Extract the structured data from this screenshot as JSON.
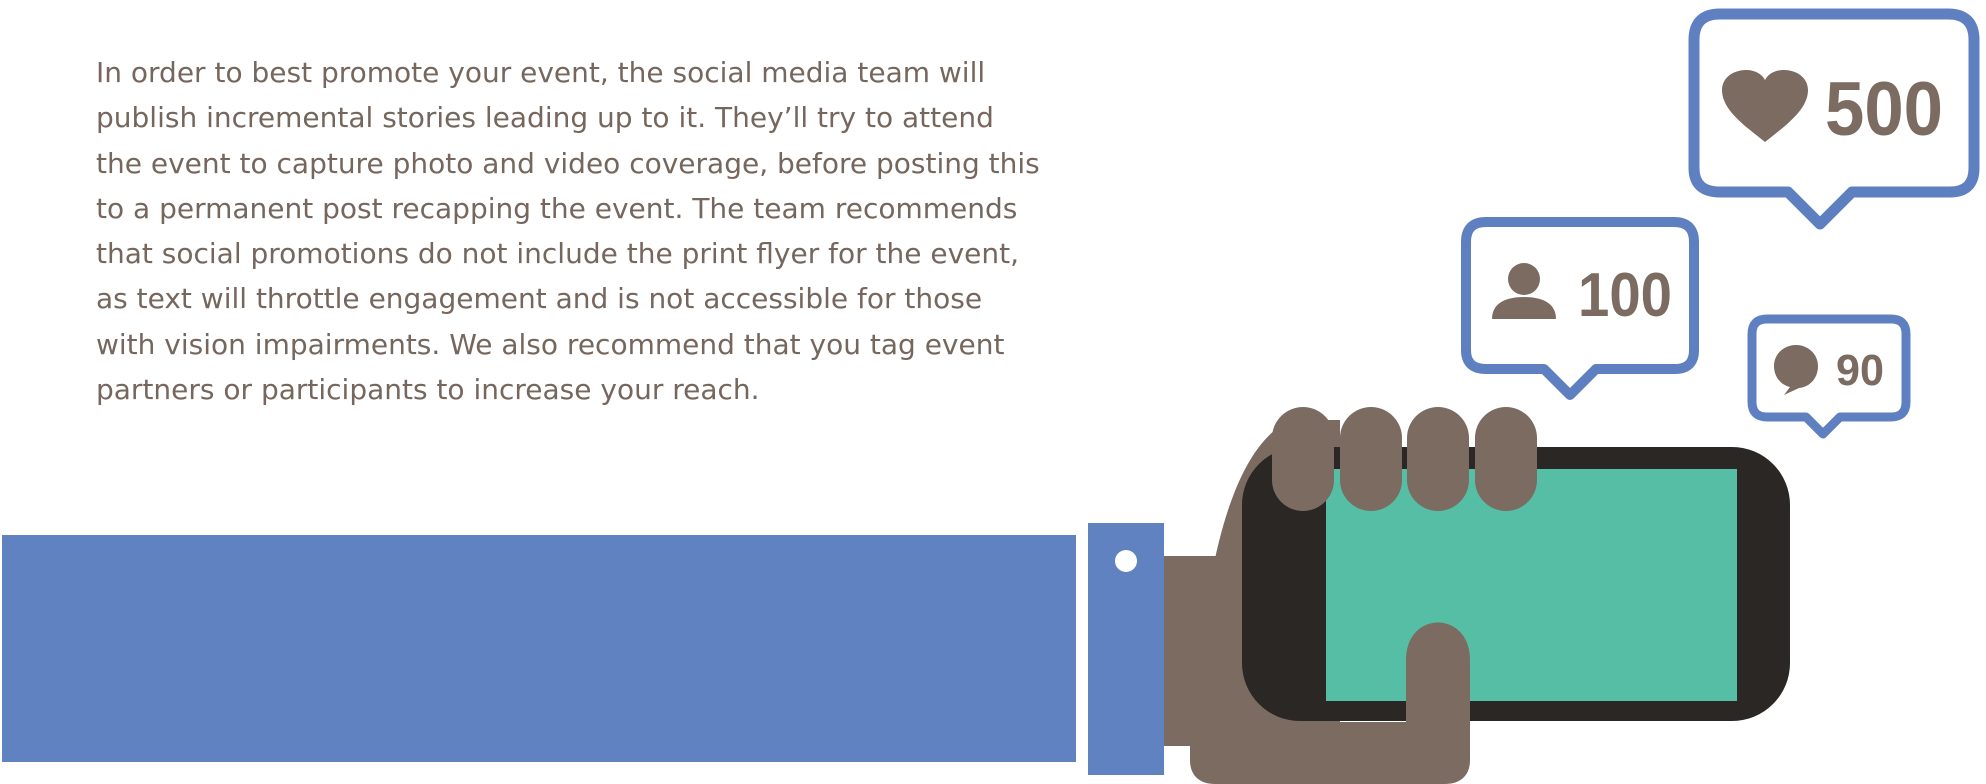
{
  "article": {
    "lines": [
      "In order to best promote your event, the social media team will",
      "publish incremental stories leading up to it. They’ll try to attend",
      "the event to capture photo and video coverage, before posting this",
      "to a permanent post recapping the event. The team recommends",
      "that social promotions do not include the print flyer for the event,",
      "as text will throttle engagement and is not accessible for those",
      "with vision impairments. We also recommend that you tag event",
      "partners or participants to increase your reach."
    ]
  },
  "illustration": {
    "likes_count": "500",
    "followers_count": "100",
    "comments_count": "90",
    "icons": [
      "heart-icon",
      "person-icon",
      "comment-icon"
    ],
    "colors": {
      "sleeve": "#6182c0",
      "bubble_outline": "#5f80c0",
      "hand": "#7b6b61",
      "phone_body": "#2a2724",
      "phone_screen": "#55bea4",
      "text": "#76675e"
    }
  }
}
